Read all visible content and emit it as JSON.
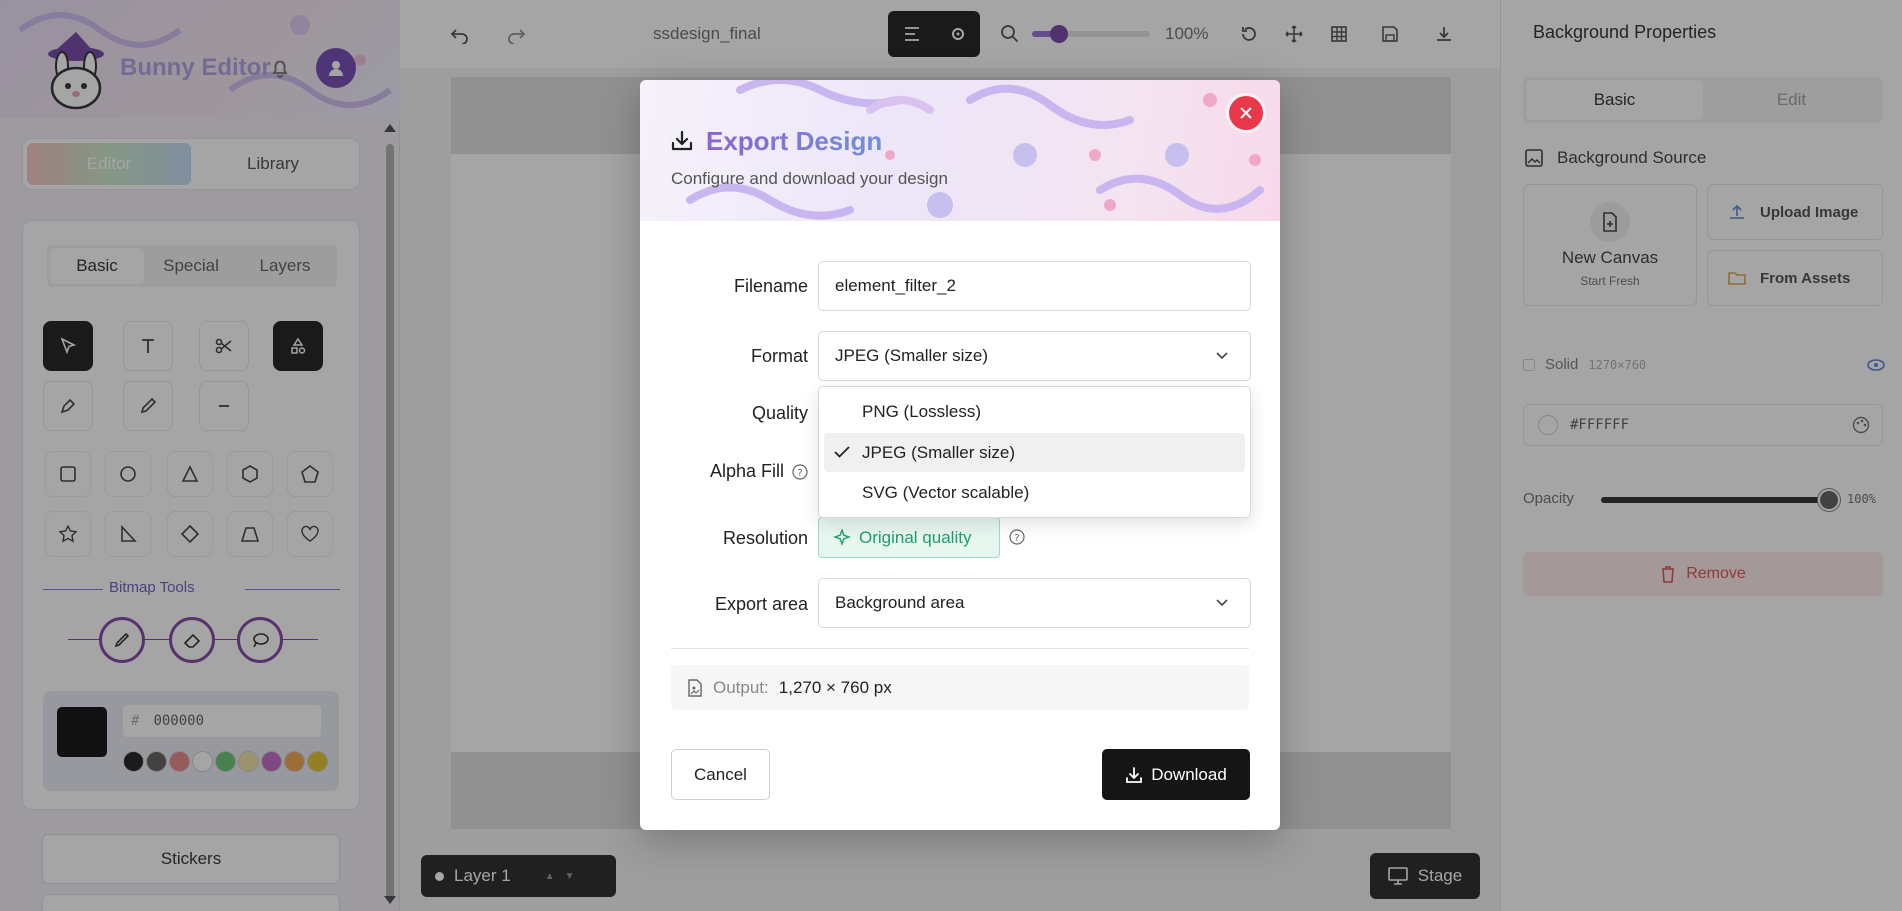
{
  "app": {
    "name": "Bunny Editor",
    "left_tabs": [
      "Editor",
      "Library"
    ],
    "tool_tabs": [
      "Basic",
      "Special",
      "Layers"
    ],
    "bitmap_tools_label": "Bitmap Tools",
    "color_hex_prefix": "#",
    "color_hex": "000000",
    "stickers_label": "Stickers",
    "palette": [
      "#111111",
      "#555555",
      "#e88080",
      "#ffffff",
      "#5cc36a",
      "#f0e0a0",
      "#c060c0",
      "#f0a040",
      "#e0c020"
    ]
  },
  "toolbar": {
    "filename": "ssdesign_final",
    "zoom": "100%"
  },
  "bottom": {
    "layer_label": "Layer 1",
    "stage_label": "Stage"
  },
  "right_panel": {
    "title": "Background Properties",
    "tabs": [
      "Basic",
      "Edit"
    ],
    "source_label": "Background Source",
    "new_canvas": "New Canvas",
    "new_canvas_sub": "Start Fresh",
    "upload_image": "Upload Image",
    "from_assets": "From Assets",
    "solid_label": "Solid",
    "solid_size": "1270×760",
    "color_value": "#FFFFFF",
    "opacity_label": "Opacity",
    "opacity_value": "100%",
    "opacity_fraction": 1.0,
    "remove_label": "Remove"
  },
  "dialog": {
    "title": "Export Design",
    "subtitle": "Configure and download your design",
    "filename_label": "Filename",
    "filename_value": "element_filter_2",
    "format_label": "Format",
    "format_value": "JPEG (Smaller size)",
    "format_options": [
      "PNG (Lossless)",
      "JPEG (Smaller size)",
      "SVG (Vector scalable)"
    ],
    "selected_option_index": 1,
    "quality_label": "Quality",
    "alpha_fill_label": "Alpha Fill",
    "resolution_label": "Resolution",
    "resolution_value": "Original quality",
    "export_area_label": "Export area",
    "export_area_value": "Background area",
    "output_label": "Output:",
    "output_value": "1,270 × 760 px",
    "cancel_label": "Cancel",
    "download_label": "Download"
  }
}
